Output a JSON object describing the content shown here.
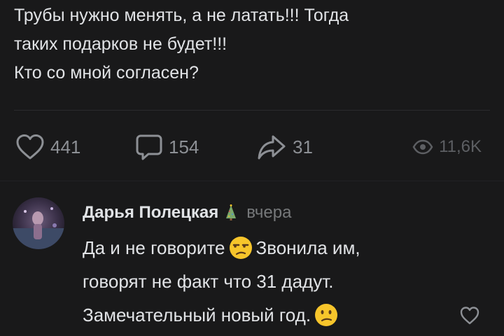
{
  "post": {
    "text_lines": [
      "Трубы нужно менять, а не латать!!! Тогда",
      "таких подарков не будет!!!",
      "Кто со мной согласен?"
    ]
  },
  "actions": {
    "likes": "441",
    "comments": "154",
    "shares": "31",
    "views": "11,6K"
  },
  "comment": {
    "author": "Дарья Полецкая",
    "time": "вчера",
    "line1_part1": "Да и не говорите",
    "line1_part2": "Звонила им,",
    "line2": "говорят не факт что 31 дадут.",
    "line3": "Замечательный новый год."
  },
  "icons": {
    "like": "heart-outline-icon",
    "comment": "speech-bubble-icon",
    "share": "share-arrow-icon",
    "views": "eye-icon",
    "author_badge": "christmas-tree-icon",
    "emoji1": "unamused-face-emoji",
    "emoji2": "confused-face-emoji",
    "comment_like": "heart-outline-icon"
  },
  "colors": {
    "background": "#19191a",
    "text": "#e1e3e6",
    "muted": "#8d9095",
    "emoji_yellow": "#f7c52b"
  }
}
